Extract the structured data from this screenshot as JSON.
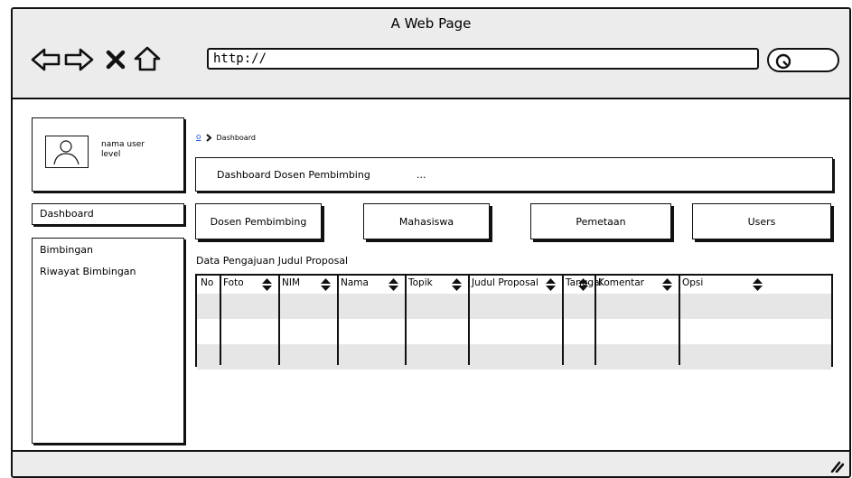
{
  "browser": {
    "title": "A Web Page",
    "url": "http://",
    "icons": [
      "back-arrow-icon",
      "forward-arrow-icon",
      "close-x-icon",
      "home-icon",
      "search-icon",
      "resize-grip-icon"
    ]
  },
  "sidebar": {
    "profile": {
      "name": "nama user",
      "role": "level"
    },
    "active_item": "Dashboard",
    "items": [
      {
        "label": "Bimbingan"
      },
      {
        "label": "Riwayat Bimbingan"
      }
    ]
  },
  "breadcrumb": {
    "home_label": "o",
    "current": "Dashboard"
  },
  "heading": {
    "title": "Dashboard Dosen Pembimbing",
    "suffix": "..."
  },
  "tabs": [
    {
      "label": "Dosen Pembimbing"
    },
    {
      "label": "Mahasiswa"
    },
    {
      "label": "Pemetaan"
    },
    {
      "label": "Users"
    }
  ],
  "table": {
    "title": "Data Pengajuan Judul Proposal",
    "columns": [
      {
        "label": "No",
        "sortable": false
      },
      {
        "label": "Foto",
        "sortable": true
      },
      {
        "label": "NIM",
        "sortable": true
      },
      {
        "label": "Nama",
        "sortable": true
      },
      {
        "label": "Topik",
        "sortable": true
      },
      {
        "label": "Judul Proposal",
        "sortable": true
      },
      {
        "label": "Tanggal",
        "sortable": true
      },
      {
        "label": "Komentar",
        "sortable": true
      },
      {
        "label": "Opsi",
        "sortable": true
      }
    ],
    "rows": [
      [],
      [],
      []
    ]
  }
}
